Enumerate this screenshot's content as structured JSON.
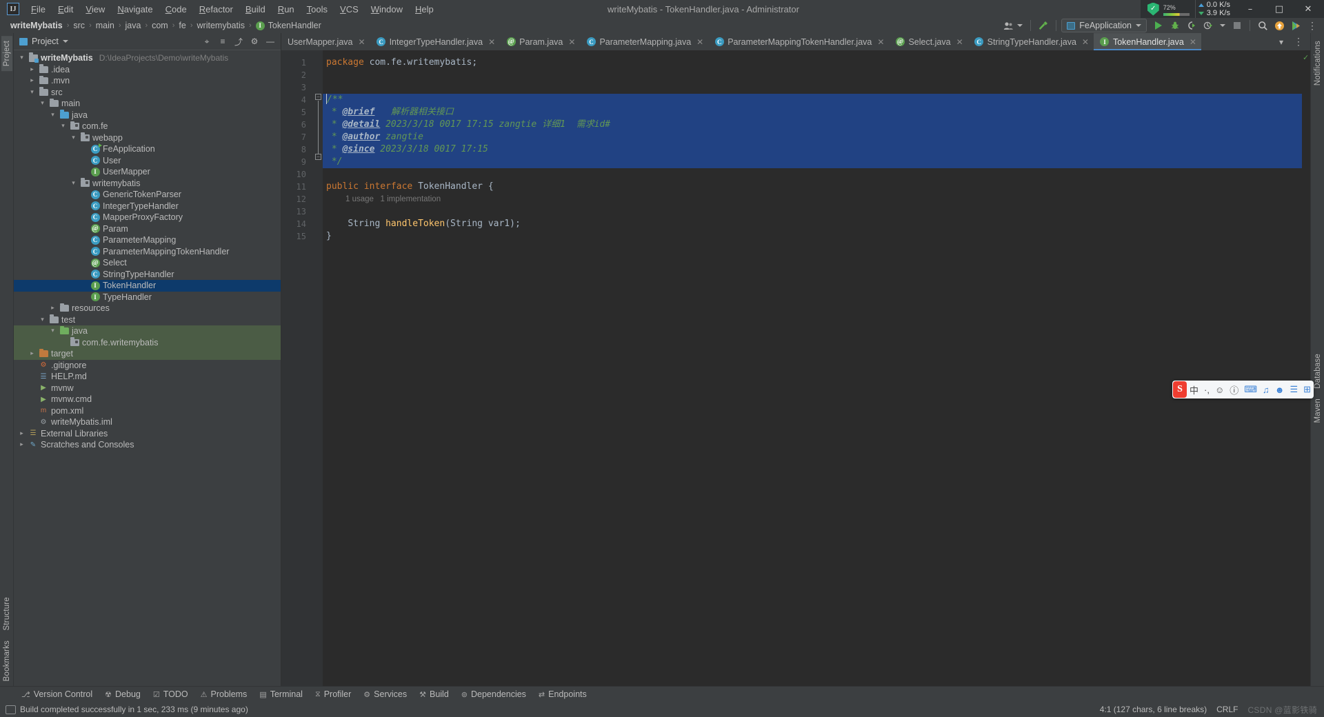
{
  "window": {
    "title": "writeMybatis - TokenHandler.java - Administrator",
    "minimize": "–",
    "maximize": "□",
    "close": "✕",
    "logo": "IJ"
  },
  "menu": {
    "items": [
      "File",
      "Edit",
      "View",
      "Navigate",
      "Code",
      "Refactor",
      "Build",
      "Run",
      "Tools",
      "VCS",
      "Window",
      "Help"
    ]
  },
  "tray": {
    "shield_icon": "shield-check-icon",
    "shield_glyph": "✓",
    "cpu_percent": "72",
    "cpu_unit": "%",
    "net_up": "0.0 K/s",
    "net_down": "3.9 K/s"
  },
  "breadcrumb": {
    "items": [
      {
        "label": "writeMybatis",
        "bold": true,
        "icon": ""
      },
      {
        "label": "src",
        "bold": false,
        "icon": ""
      },
      {
        "label": "main",
        "bold": false,
        "icon": ""
      },
      {
        "label": "java",
        "bold": false,
        "icon": ""
      },
      {
        "label": "com",
        "bold": false,
        "icon": ""
      },
      {
        "label": "fe",
        "bold": false,
        "icon": ""
      },
      {
        "label": "writemybatis",
        "bold": false,
        "icon": ""
      },
      {
        "label": "TokenHandler",
        "bold": false,
        "icon": "interface-icon"
      }
    ],
    "separator": "›"
  },
  "toolbar": {
    "user_icon": "user-account-icon",
    "build_icon": "hammer-build-icon",
    "run_config": "FeApplication",
    "run_icon": "run-play-icon",
    "debug_icon": "debug-bug-icon",
    "run_coverage_icon": "run-with-coverage-icon",
    "profiler_icon": "profiler-icon",
    "stop_icon": "stop-icon",
    "search_icon": "search-everywhere-icon",
    "update_icon": "update-project-icon",
    "ide_icon": "ide-feature-icon",
    "search_glyph": "⌕",
    "update_glyph": "↑"
  },
  "project_panel": {
    "title": "Project",
    "title_icon": "project-view-icon",
    "actions": [
      {
        "name": "select-opened-file-icon",
        "glyph": "⌖"
      },
      {
        "name": "expand-all-icon",
        "glyph": "≡"
      },
      {
        "name": "collapse-all-icon",
        "glyph": "⤴"
      },
      {
        "name": "settings-gear-icon",
        "glyph": "⚙"
      },
      {
        "name": "hide-panel-icon",
        "glyph": "—"
      }
    ],
    "tree": [
      {
        "indent": 0,
        "arrow": "v",
        "icon": "module",
        "label": "writeMybatis",
        "bold": true,
        "path": "D:\\IdeaProjects\\Demo\\writeMybatis",
        "state": ""
      },
      {
        "indent": 1,
        "arrow": ">",
        "icon": "folder",
        "label": ".idea",
        "bold": false,
        "path": "",
        "state": ""
      },
      {
        "indent": 1,
        "arrow": ">",
        "icon": "folder",
        "label": ".mvn",
        "bold": false,
        "path": "",
        "state": ""
      },
      {
        "indent": 1,
        "arrow": "v",
        "icon": "folder",
        "label": "src",
        "bold": false,
        "path": "",
        "state": ""
      },
      {
        "indent": 2,
        "arrow": "v",
        "icon": "folder",
        "label": "main",
        "bold": false,
        "path": "",
        "state": ""
      },
      {
        "indent": 3,
        "arrow": "v",
        "icon": "folder-src",
        "label": "java",
        "bold": false,
        "path": "",
        "state": ""
      },
      {
        "indent": 4,
        "arrow": "v",
        "icon": "package",
        "label": "com.fe",
        "bold": false,
        "path": "",
        "state": ""
      },
      {
        "indent": 5,
        "arrow": "v",
        "icon": "package",
        "label": "webapp",
        "bold": false,
        "path": "",
        "state": ""
      },
      {
        "indent": 6,
        "arrow": "",
        "icon": "class-run",
        "label": "FeApplication",
        "bold": false,
        "path": "",
        "state": ""
      },
      {
        "indent": 6,
        "arrow": "",
        "icon": "class",
        "label": "User",
        "bold": false,
        "path": "",
        "state": ""
      },
      {
        "indent": 6,
        "arrow": "",
        "icon": "interface",
        "label": "UserMapper",
        "bold": false,
        "path": "",
        "state": ""
      },
      {
        "indent": 5,
        "arrow": "v",
        "icon": "package",
        "label": "writemybatis",
        "bold": false,
        "path": "",
        "state": ""
      },
      {
        "indent": 6,
        "arrow": "",
        "icon": "class",
        "label": "GenericTokenParser",
        "bold": false,
        "path": "",
        "state": ""
      },
      {
        "indent": 6,
        "arrow": "",
        "icon": "class",
        "label": "IntegerTypeHandler",
        "bold": false,
        "path": "",
        "state": ""
      },
      {
        "indent": 6,
        "arrow": "",
        "icon": "class",
        "label": "MapperProxyFactory",
        "bold": false,
        "path": "",
        "state": ""
      },
      {
        "indent": 6,
        "arrow": "",
        "icon": "annotation",
        "label": "Param",
        "bold": false,
        "path": "",
        "state": ""
      },
      {
        "indent": 6,
        "arrow": "",
        "icon": "class",
        "label": "ParameterMapping",
        "bold": false,
        "path": "",
        "state": ""
      },
      {
        "indent": 6,
        "arrow": "",
        "icon": "class",
        "label": "ParameterMappingTokenHandler",
        "bold": false,
        "path": "",
        "state": ""
      },
      {
        "indent": 6,
        "arrow": "",
        "icon": "annotation",
        "label": "Select",
        "bold": false,
        "path": "",
        "state": ""
      },
      {
        "indent": 6,
        "arrow": "",
        "icon": "class",
        "label": "StringTypeHandler",
        "bold": false,
        "path": "",
        "state": ""
      },
      {
        "indent": 6,
        "arrow": "",
        "icon": "interface",
        "label": "TokenHandler",
        "bold": false,
        "path": "",
        "state": "selected"
      },
      {
        "indent": 6,
        "arrow": "",
        "icon": "interface",
        "label": "TypeHandler",
        "bold": false,
        "path": "",
        "state": ""
      },
      {
        "indent": 3,
        "arrow": ">",
        "icon": "folder",
        "label": "resources",
        "bold": false,
        "path": "",
        "state": ""
      },
      {
        "indent": 2,
        "arrow": "v",
        "icon": "folder",
        "label": "test",
        "bold": false,
        "path": "",
        "state": ""
      },
      {
        "indent": 3,
        "arrow": "v",
        "icon": "folder-test",
        "label": "java",
        "bold": false,
        "path": "",
        "state": "green"
      },
      {
        "indent": 4,
        "arrow": "",
        "icon": "package",
        "label": "com.fe.writemybatis",
        "bold": false,
        "path": "",
        "state": "green"
      },
      {
        "indent": 1,
        "arrow": ">",
        "icon": "folder-target",
        "label": "target",
        "bold": false,
        "path": "",
        "state": "green"
      },
      {
        "indent": 1,
        "arrow": "",
        "icon": "file-git",
        "label": ".gitignore",
        "bold": false,
        "path": "",
        "state": ""
      },
      {
        "indent": 1,
        "arrow": "",
        "icon": "file-md",
        "label": "HELP.md",
        "bold": false,
        "path": "",
        "state": ""
      },
      {
        "indent": 1,
        "arrow": "",
        "icon": "file-sh",
        "label": "mvnw",
        "bold": false,
        "path": "",
        "state": ""
      },
      {
        "indent": 1,
        "arrow": "",
        "icon": "file-cmd",
        "label": "mvnw.cmd",
        "bold": false,
        "path": "",
        "state": ""
      },
      {
        "indent": 1,
        "arrow": "",
        "icon": "file-xml",
        "label": "pom.xml",
        "bold": false,
        "path": "",
        "state": ""
      },
      {
        "indent": 1,
        "arrow": "",
        "icon": "file-iml",
        "label": "writeMybatis.iml",
        "bold": false,
        "path": "",
        "state": ""
      },
      {
        "indent": 0,
        "arrow": ">",
        "icon": "libraries",
        "label": "External Libraries",
        "bold": false,
        "path": "",
        "state": ""
      },
      {
        "indent": 0,
        "arrow": ">",
        "icon": "scratches",
        "label": "Scratches and Consoles",
        "bold": false,
        "path": "",
        "state": ""
      }
    ]
  },
  "left_rail": {
    "tabs": [
      "Project",
      "Structure",
      "Bookmarks"
    ]
  },
  "right_rail": {
    "tabs": [
      "Notifications",
      "Database",
      "Maven"
    ]
  },
  "editor": {
    "tabs": [
      {
        "label": "UserMapper.java",
        "icon": "",
        "active": false
      },
      {
        "label": "IntegerTypeHandler.java",
        "icon": "class",
        "active": false
      },
      {
        "label": "Param.java",
        "icon": "annotation",
        "active": false
      },
      {
        "label": "ParameterMapping.java",
        "icon": "class",
        "active": false
      },
      {
        "label": "ParameterMappingTokenHandler.java",
        "icon": "class",
        "active": false
      },
      {
        "label": "Select.java",
        "icon": "annotation",
        "active": false
      },
      {
        "label": "StringTypeHandler.java",
        "icon": "class",
        "active": false
      },
      {
        "label": "TokenHandler.java",
        "icon": "interface",
        "active": true
      }
    ],
    "close_glyph": "✕",
    "tab_actions": [
      {
        "name": "tab-list-icon",
        "glyph": "⌄"
      },
      {
        "name": "tab-more-icon",
        "glyph": "⋮"
      }
    ],
    "line_numbers": [
      "1",
      "2",
      "3",
      "4",
      "5",
      "6",
      "7",
      "8",
      "9",
      "10",
      "11",
      "12",
      "13",
      "14",
      "15"
    ],
    "gutter_marks": [
      {
        "line": 11,
        "glyph": "I"
      },
      {
        "line": 13,
        "glyph": "I"
      }
    ],
    "lines": [
      {
        "n": 1,
        "hl": false,
        "tokens": [
          {
            "t": "package ",
            "c": "k"
          },
          {
            "t": "com.fe.writemybatis",
            "c": "id"
          },
          {
            "t": ";",
            "c": "id"
          }
        ]
      },
      {
        "n": 2,
        "hl": false,
        "tokens": []
      },
      {
        "n": 3,
        "hl": false,
        "tokens": []
      },
      {
        "n": 4,
        "hl": true,
        "tokens": [
          {
            "t": "/**",
            "c": "cm"
          }
        ]
      },
      {
        "n": 5,
        "hl": true,
        "tokens": [
          {
            "t": " * ",
            "c": "cm"
          },
          {
            "t": "@brief",
            "c": "cmtag"
          },
          {
            "t": "   解析器相关接口",
            "c": "cmv"
          }
        ]
      },
      {
        "n": 6,
        "hl": true,
        "tokens": [
          {
            "t": " * ",
            "c": "cm"
          },
          {
            "t": "@detail",
            "c": "cmtag"
          },
          {
            "t": " 2023/3/18 0017 17:15 zangtie ",
            "c": "cmv"
          },
          {
            "t": "详细1",
            "c": "cmv"
          },
          {
            "t": "  需求id#",
            "c": "cmv"
          }
        ]
      },
      {
        "n": 7,
        "hl": true,
        "tokens": [
          {
            "t": " * ",
            "c": "cm"
          },
          {
            "t": "@author",
            "c": "cmtag"
          },
          {
            "t": " zangtie",
            "c": "cmv"
          }
        ]
      },
      {
        "n": 8,
        "hl": true,
        "tokens": [
          {
            "t": " * ",
            "c": "cm"
          },
          {
            "t": "@since",
            "c": "cmtag"
          },
          {
            "t": " 2023/3/18 0017 17:15",
            "c": "cmv"
          }
        ]
      },
      {
        "n": 9,
        "hl": true,
        "tokens": [
          {
            "t": " */",
            "c": "cm"
          }
        ]
      },
      {
        "n": 10,
        "hl": false,
        "tokens": []
      },
      {
        "n": 11,
        "hl": false,
        "tokens": [
          {
            "t": "public ",
            "c": "k"
          },
          {
            "t": "interface ",
            "c": "k"
          },
          {
            "t": "TokenHandler",
            "c": "ty"
          },
          {
            "t": " {",
            "c": "id"
          }
        ]
      },
      {
        "n": 12,
        "hl": false,
        "tokens": []
      },
      {
        "n": 13,
        "hl": false,
        "tokens": [
          {
            "t": "    ",
            "c": "id"
          },
          {
            "t": "String",
            "c": "ty"
          },
          {
            "t": " ",
            "c": "id"
          },
          {
            "t": "handleToken",
            "c": "fn"
          },
          {
            "t": "(",
            "c": "id"
          },
          {
            "t": "String",
            "c": "ty"
          },
          {
            "t": " var1);",
            "c": "id"
          }
        ]
      },
      {
        "n": 14,
        "hl": false,
        "tokens": [
          {
            "t": "}",
            "c": "id"
          }
        ]
      },
      {
        "n": 15,
        "hl": false,
        "tokens": []
      }
    ],
    "inlay_hint": "1 usage   1 implementation",
    "inlay_hint_line": 12,
    "inspection_ok_glyph": "✓"
  },
  "bottom_toolwindows": {
    "items": [
      {
        "label": "Version Control",
        "icon": "version-control-icon",
        "glyph": "⎇"
      },
      {
        "label": "Debug",
        "icon": "debug-icon",
        "glyph": "☢"
      },
      {
        "label": "TODO",
        "icon": "todo-icon",
        "glyph": "☑"
      },
      {
        "label": "Problems",
        "icon": "problems-icon",
        "glyph": "⚠"
      },
      {
        "label": "Terminal",
        "icon": "terminal-icon",
        "glyph": "▤"
      },
      {
        "label": "Profiler",
        "icon": "profiler-icon",
        "glyph": "⧖"
      },
      {
        "label": "Services",
        "icon": "services-icon",
        "glyph": "⚙"
      },
      {
        "label": "Build",
        "icon": "build-hammer-icon",
        "glyph": "⚒"
      },
      {
        "label": "Dependencies",
        "icon": "dependencies-icon",
        "glyph": "⊚"
      },
      {
        "label": "Endpoints",
        "icon": "endpoints-icon",
        "glyph": "⇄"
      }
    ]
  },
  "status_bar": {
    "message": "Build completed successfully in 1 sec, 233 ms (9 minutes ago)",
    "caret_position": "4:1 (127 chars, 6 line breaks)",
    "line_separator": "CRLF",
    "watermark": "CSDN @蓝影铁骑"
  },
  "ime": {
    "logo": "S",
    "mode": "中",
    "items": [
      "·,",
      "☺",
      "ⓘ",
      "⌨",
      "♫",
      "☻",
      "☰",
      "⊞"
    ]
  },
  "colors": {
    "bg_panel": "#3c3f41",
    "bg_editor": "#2b2b2b",
    "bg_gutter": "#313335",
    "selection": "#214283",
    "tree_selection": "#0d3a6b",
    "accent_blue": "#4a88c7",
    "green": "#5a9e4e",
    "class_icon": "#3a9bc1",
    "keyword": "#cc7832",
    "comment": "#629755",
    "method": "#ffc66d",
    "text": "#bbbbbb"
  }
}
